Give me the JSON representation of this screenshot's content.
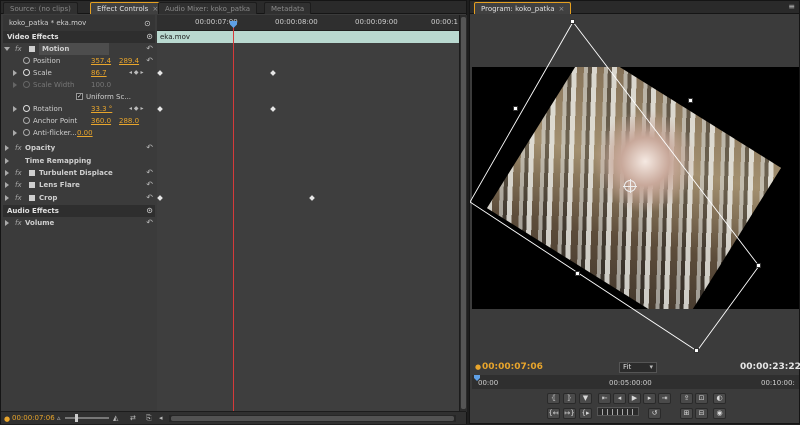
{
  "tabs_left": [
    {
      "label": "Source: (no clips)",
      "active": false
    },
    {
      "label": "Effect Controls",
      "active": true
    },
    {
      "label": "Audio Mixer: koko_patka",
      "active": false
    },
    {
      "label": "Metadata",
      "active": false
    }
  ],
  "close_glyph": "×",
  "effect_controls": {
    "sequence_clip": "koko_patka * eka.mov",
    "ruler_times": [
      "00:00:07:00",
      "00:00:08:00",
      "00:00:09:00",
      "00:00:1"
    ],
    "clip_bar": "eka.mov",
    "sections": {
      "video": "Video Effects",
      "audio": "Audio Effects"
    },
    "motion": {
      "label": "Motion",
      "position": {
        "label": "Position",
        "x": "357.4",
        "y": "289.4"
      },
      "scale": {
        "label": "Scale",
        "value": "86.7"
      },
      "scale_width": {
        "label": "Scale Width",
        "value": "100.0"
      },
      "uniform_scale": {
        "label": "Uniform Sc...",
        "checked": true
      },
      "rotation": {
        "label": "Rotation",
        "value": "33.3 °"
      },
      "anchor_point": {
        "label": "Anchor Point",
        "x": "360.0",
        "y": "288.0"
      },
      "anti_flicker": {
        "label": "Anti-flicker...",
        "value": "0.00"
      }
    },
    "other_effects": [
      "Opacity",
      "Time Remapping",
      "Turbulent Displace",
      "Lens Flare",
      "Crop"
    ],
    "audio_effects": [
      "Volume"
    ],
    "footer_timecode": "00:00:07:06"
  },
  "program_tab": "Program: koko_patka",
  "program": {
    "current_timecode": "00:00:07:06",
    "duration_timecode": "00:00:23:22",
    "fit_label": "Fit",
    "ruler_times": [
      "00:00",
      "00:05:00:00",
      "00:10:00:"
    ]
  },
  "colors": {
    "accent": "#e8a52c",
    "clip_bar": "#b9d9d0",
    "playhead_line": "#d53a3a",
    "playhead": "#5fa0e6"
  }
}
